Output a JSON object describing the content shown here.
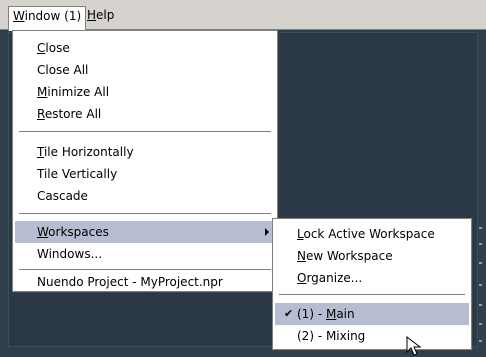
{
  "menubar": {
    "window_menu": {
      "prefix": "",
      "accel": "W",
      "rest": "indow (1)"
    },
    "help_menu": {
      "accel": "H",
      "rest": "elp"
    }
  },
  "window_menu": {
    "items": [
      {
        "accel": "C",
        "rest": "lose"
      },
      {
        "accel": "",
        "rest": "Close All"
      },
      {
        "accel": "M",
        "rest": "inimize All"
      },
      {
        "accel": "R",
        "rest": "estore All"
      },
      {
        "accel": "T",
        "rest": "ile Horizontally"
      },
      {
        "accel": "",
        "rest": "Tile Vertically"
      },
      {
        "accel": "",
        "rest": "Cascade"
      },
      {
        "accel": "W",
        "rest": "orkspaces"
      },
      {
        "accel": "",
        "rest": "Windows..."
      },
      {
        "accel": "",
        "rest": "Nuendo Project - MyProject.npr"
      }
    ]
  },
  "workspaces_menu": {
    "items": [
      {
        "accel": "L",
        "rest": "ock Active Workspace"
      },
      {
        "accel": "N",
        "rest": "ew Workspace"
      },
      {
        "accel": "O",
        "rest": "rganize..."
      }
    ],
    "workspaces": [
      {
        "prefix": "(1) - ",
        "accel": "M",
        "rest": "ain",
        "checked": true,
        "check_mark": "✔"
      },
      {
        "prefix": "(2) - Mixing",
        "accel": "",
        "rest": "",
        "checked": false,
        "check_mark": ""
      }
    ]
  },
  "colors": {
    "menu_bg": "#ffffff",
    "highlight": "#b6bdd2",
    "app_bg": "#2b3946",
    "menubar_bg": "#d6d3ce"
  },
  "icons": {
    "submenu_arrow": "submenu-arrow-icon",
    "checkmark": "checkmark-icon",
    "cursor": "mouse-cursor-icon"
  }
}
